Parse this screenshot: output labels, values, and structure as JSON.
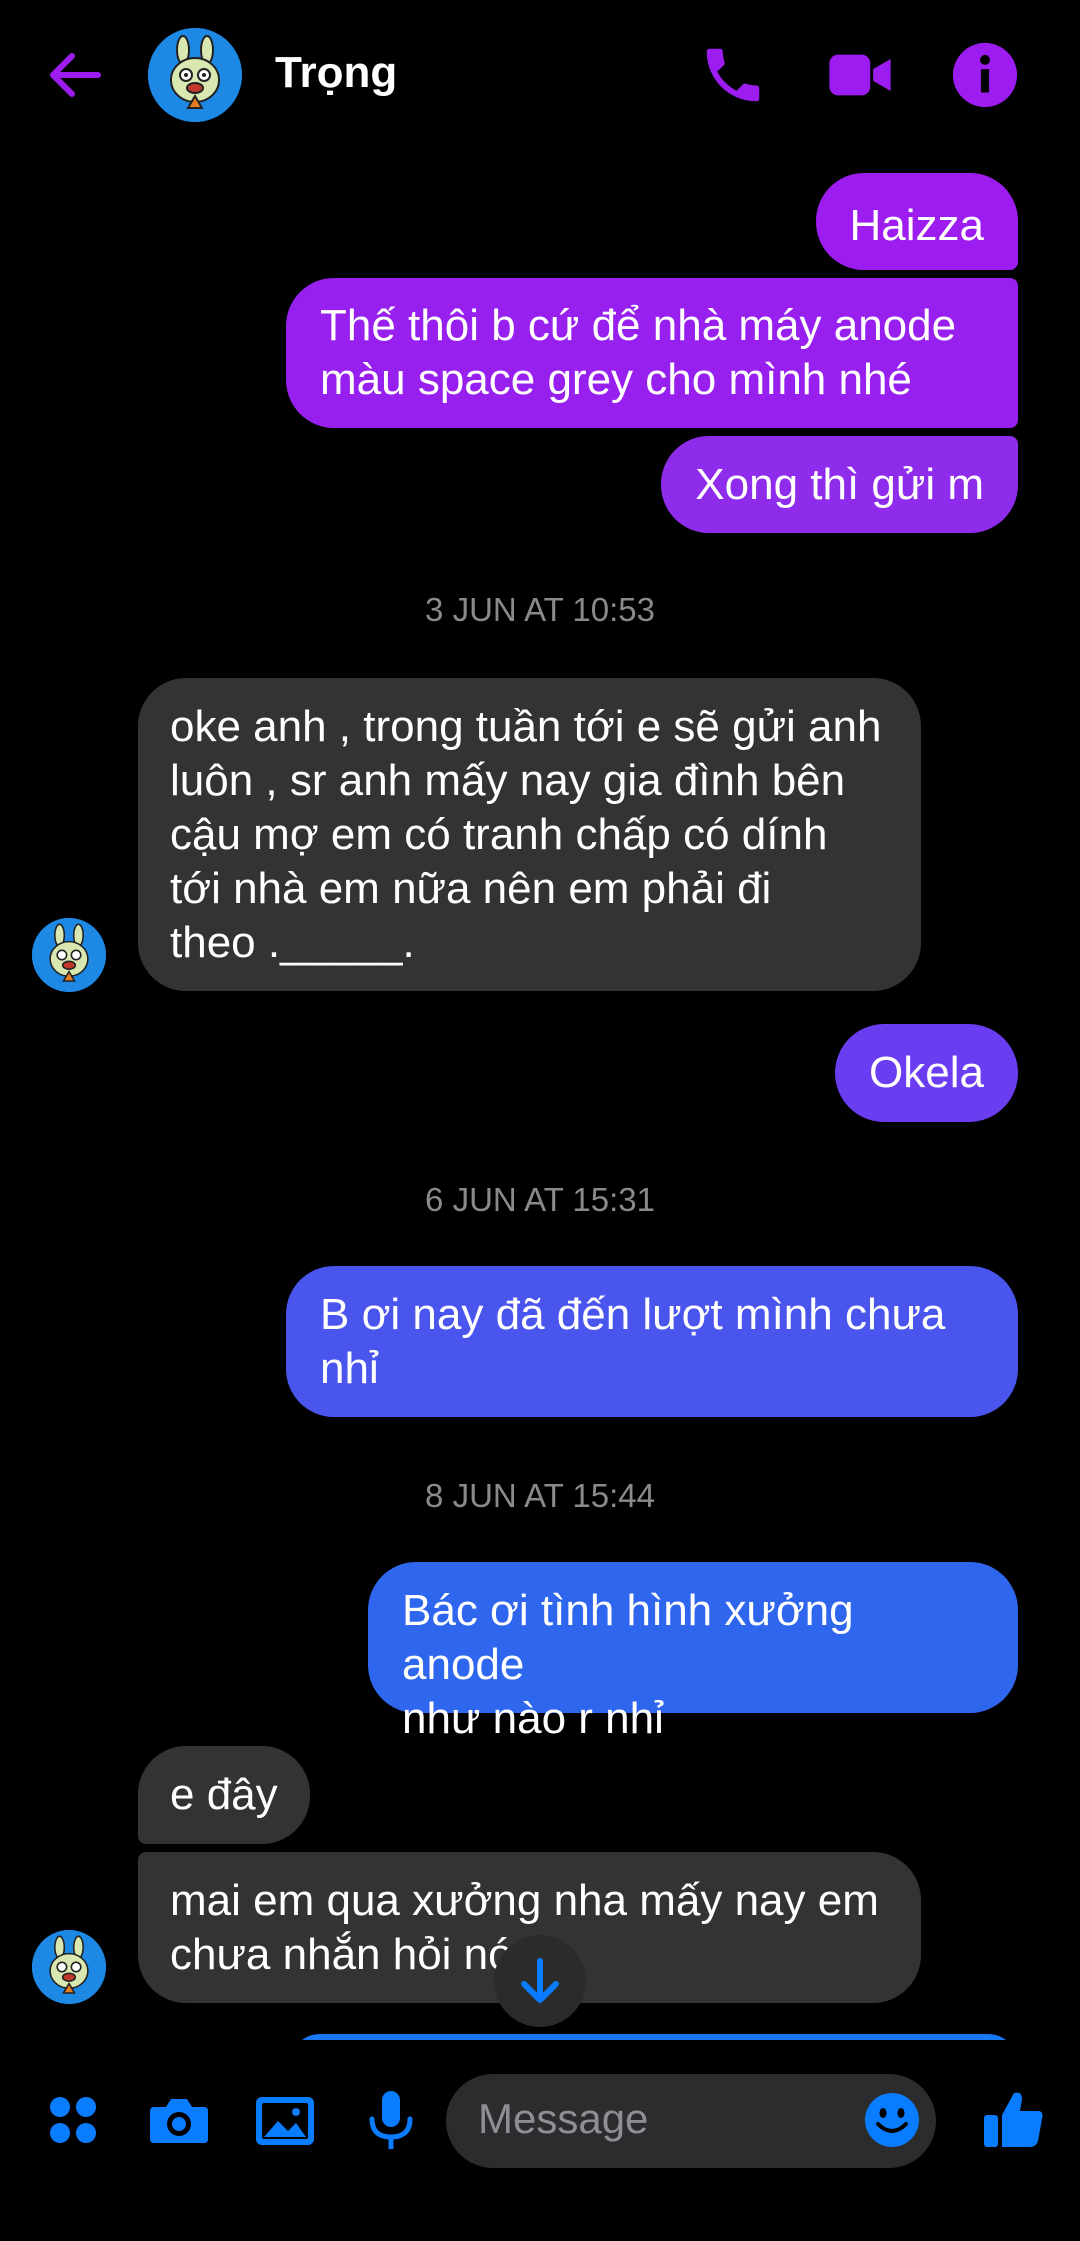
{
  "header": {
    "contact_name": "Trọng",
    "icons": [
      "back-arrow-icon",
      "phone-icon",
      "video-camera-icon",
      "info-icon"
    ],
    "accent_color": "#9d1cf0"
  },
  "conversation": {
    "m1": "Haizza",
    "m2_line1": "Thế thôi b cứ để nhà máy anode",
    "m2_line2": "màu space grey cho mình nhé",
    "m3": "Xong thì gửi m",
    "ts1": "3 JUN AT 10:53",
    "m4_line1": "oke anh , trong tuần tới e sẽ gửi anh",
    "m4_line2": "luôn , sr anh mấy nay gia đình bên",
    "m4_line3": "cậu mợ em có tranh chấp có dính",
    "m4_line4": "tới nhà em nữa nên em phải đi",
    "m4_line5": "theo ._____.",
    "m5": "Okela",
    "ts2": "6 JUN AT 15:31",
    "m6_line1": "B ơi nay đã đến lượt mình chưa",
    "m6_line2": "nhỉ",
    "ts3": "8 JUN AT 15:44",
    "m7_line1": "Bác ơi tình hình xưởng anode",
    "m7_line2": "như nào r nhỉ",
    "m8": "e đây",
    "m9_line1": "mai em qua xưởng nha mấy nay em",
    "m9_line2": "chưa nhắn hỏi nó"
  },
  "composer": {
    "placeholder": "Message",
    "icons": [
      "apps-menu-icon",
      "camera-icon",
      "gallery-icon",
      "microphone-icon",
      "emoji-icon",
      "thumbs-up-icon"
    ],
    "accent_color": "#0a7cff"
  }
}
